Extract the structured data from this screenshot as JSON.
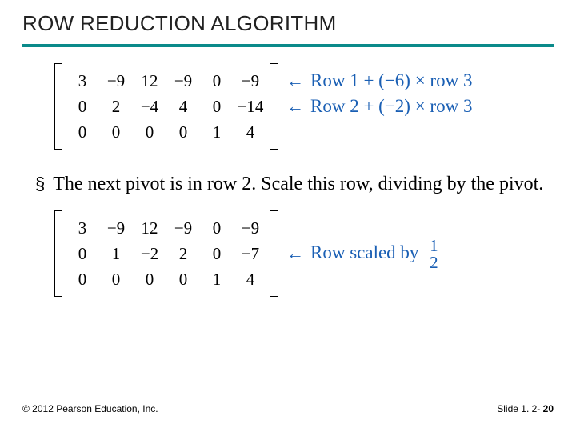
{
  "header": {
    "title": "ROW REDUCTION ALGORITHM"
  },
  "matrix1": {
    "rows": [
      [
        "3",
        "−9",
        "12",
        "−9",
        "0",
        "−9"
      ],
      [
        "0",
        "2",
        "−4",
        "4",
        "0",
        "−14"
      ],
      [
        "0",
        "0",
        "0",
        "0",
        "1",
        "4"
      ]
    ],
    "annot": [
      {
        "arrow": "←",
        "text": "Row 1 + (−6) × row 3"
      },
      {
        "arrow": "←",
        "text": "Row 2 + (−2) × row 3"
      }
    ]
  },
  "bullet": {
    "marker": "§",
    "text": "The next pivot is in row 2. Scale this row, dividing by the pivot."
  },
  "matrix2": {
    "rows": [
      [
        "3",
        "−9",
        "12",
        "−9",
        "0",
        "−9"
      ],
      [
        "0",
        "1",
        "−2",
        "2",
        "0",
        "−7"
      ],
      [
        "0",
        "0",
        "0",
        "0",
        "1",
        "4"
      ]
    ],
    "annot": {
      "arrow": "←",
      "prefix": "Row scaled by",
      "frac_num": "1",
      "frac_den": "2"
    }
  },
  "footer": {
    "copyright": "© 2012 Pearson Education, Inc.",
    "slide_label": "Slide 1. 2- ",
    "slide_num": "20"
  }
}
